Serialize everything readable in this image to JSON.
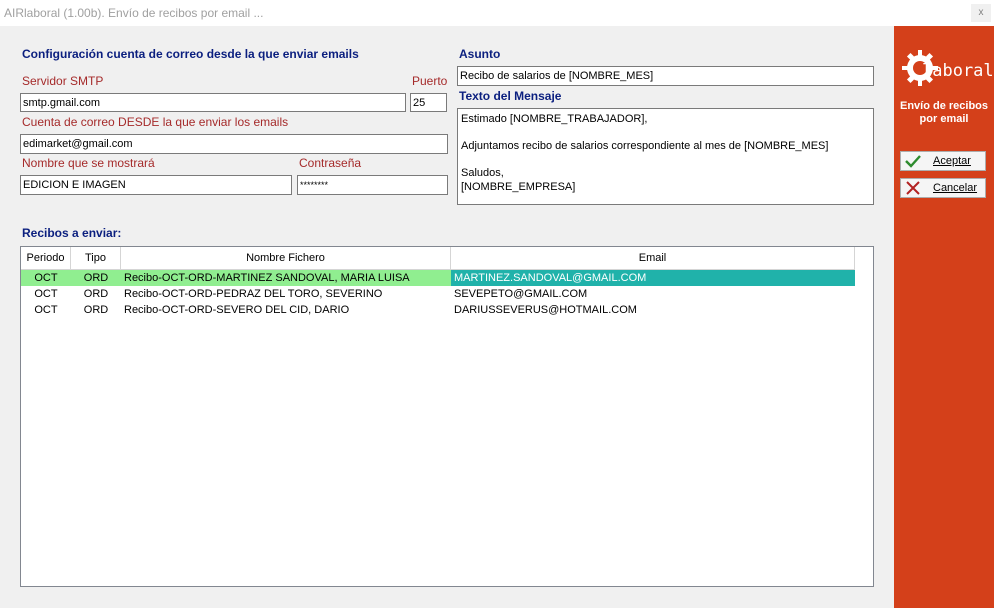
{
  "window": {
    "title": "AIRlaboral (1.00b). Envío de recibos por email ...",
    "close_label": "x"
  },
  "config": {
    "section_title": "Configuración cuenta de correo desde la que enviar emails",
    "smtp_label": "Servidor SMTP",
    "smtp_value": "smtp.gmail.com",
    "port_label": "Puerto",
    "port_value": "25",
    "from_label": "Cuenta de correo DESDE la que enviar los emails",
    "from_value": "edimarket@gmail.com",
    "display_name_label": "Nombre que se mostrará",
    "display_name_value": "EDICION E IMAGEN",
    "password_label": "Contraseña",
    "password_value": "********"
  },
  "message": {
    "subject_label": "Asunto",
    "subject_value": "Recibo de salarios de [NOMBRE_MES]",
    "body_label": "Texto del Mensaje",
    "body_lines": [
      "Estimado [NOMBRE_TRABAJADOR],",
      "",
      "Adjuntamos recibo de salarios correspondiente al mes de [NOMBRE_MES]",
      "",
      "Saludos,",
      "[NOMBRE_EMPRESA]"
    ]
  },
  "recibos": {
    "section_title": "Recibos a enviar:",
    "columns": [
      "Periodo",
      "Tipo",
      "Nombre Fichero",
      "Email"
    ],
    "rows": [
      {
        "periodo": "OCT",
        "tipo": "ORD",
        "fichero": "Recibo-OCT-ORD-MARTINEZ SANDOVAL, MARIA LUISA",
        "email": "MARTINEZ.SANDOVAL@GMAIL.COM",
        "selected": true
      },
      {
        "periodo": "OCT",
        "tipo": "ORD",
        "fichero": "Recibo-OCT-ORD-PEDRAZ DEL TORO, SEVERINO",
        "email": "SEVEPETO@GMAIL.COM",
        "selected": false
      },
      {
        "periodo": "OCT",
        "tipo": "ORD",
        "fichero": "Recibo-OCT-ORD-SEVERO DEL CID, DARIO",
        "email": "DARIUSSEVERUS@HOTMAIL.COM",
        "selected": false
      }
    ]
  },
  "sidebar": {
    "logo_text": "laboral",
    "title": "Envío de recibos por email",
    "accept_label": "Aceptar",
    "cancel_label": "Cancelar"
  },
  "colors": {
    "sidebar_bg": "#d4401a",
    "section_title": "#0b1f7f",
    "field_label": "#a52a2a",
    "row_selected": "#90ee90",
    "email_selected": "#20b2aa"
  },
  "icons": {
    "accept": "check-icon",
    "cancel": "x-icon",
    "logo": "gear-logo-icon"
  }
}
